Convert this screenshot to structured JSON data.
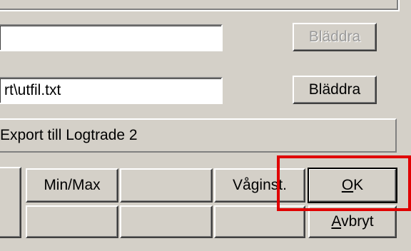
{
  "input_row_1": {
    "value": "",
    "browse_label": "Bläddra"
  },
  "input_row_2": {
    "value": "rt\\utfil.txt",
    "browse_label": "Bläddra"
  },
  "export_panel": {
    "label": "Export till Logtrade 2"
  },
  "buttons": {
    "row1": {
      "minmax": "Min/Max",
      "empty": "",
      "vaginst": "Våginst.",
      "ok_mnemonic": "O",
      "ok_rest": "K"
    },
    "row2": {
      "cancel_mnemonic": "A",
      "cancel_rest": "vbryt"
    }
  },
  "highlight_color": "#e00000"
}
